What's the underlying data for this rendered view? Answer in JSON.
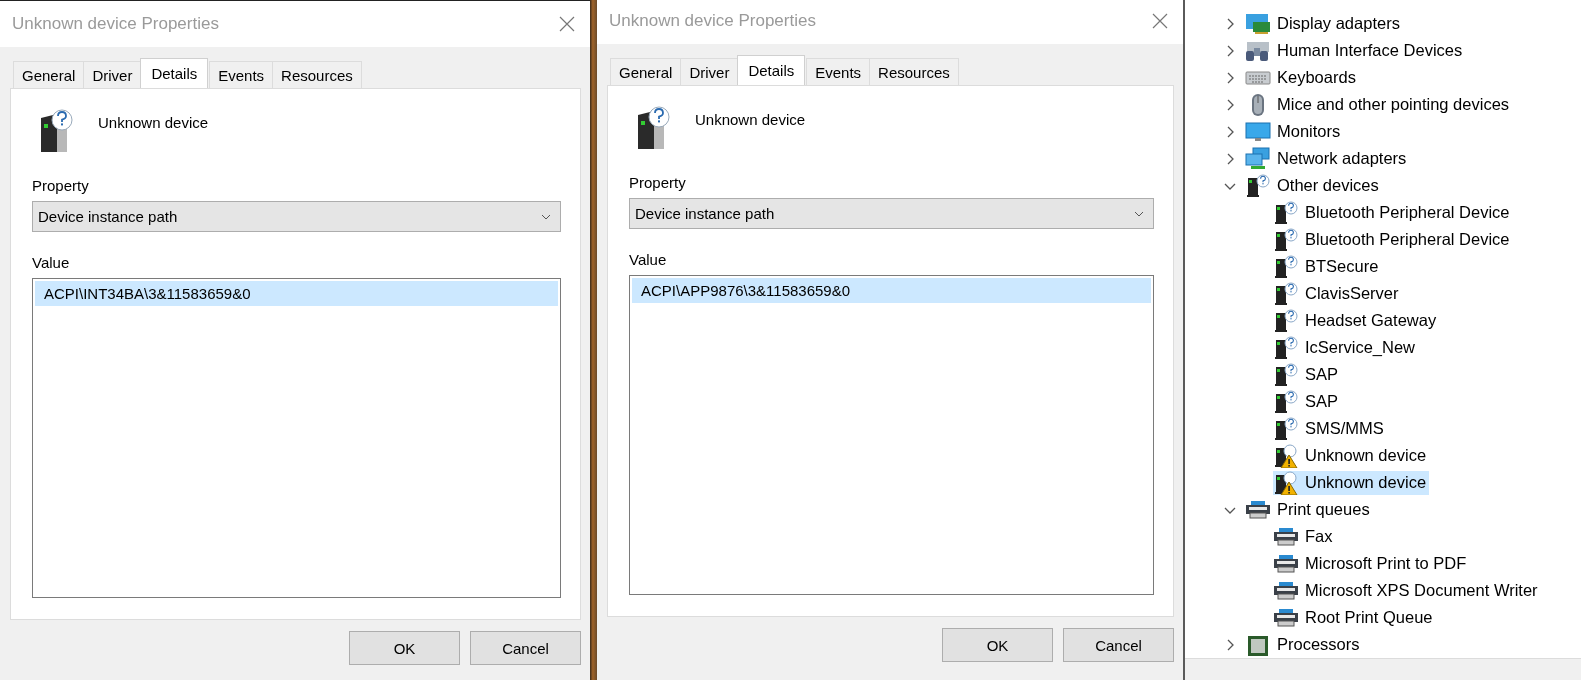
{
  "dialogs": [
    {
      "title": "Unknown device Properties",
      "tabs": [
        {
          "label": "General",
          "selected": false
        },
        {
          "label": "Driver",
          "selected": false
        },
        {
          "label": "Details",
          "selected": true
        },
        {
          "label": "Events",
          "selected": false
        },
        {
          "label": "Resources",
          "selected": false
        }
      ],
      "device_name": "Unknown device",
      "property_label": "Property",
      "property": "Device instance path",
      "value_label": "Value",
      "values": [
        {
          "text": "ACPI\\INT34BA\\3&11583659&0",
          "selected": true
        }
      ],
      "buttons": [
        "OK",
        "Cancel"
      ]
    },
    {
      "title": "Unknown device Properties",
      "tabs": [
        {
          "label": "General",
          "selected": false
        },
        {
          "label": "Driver",
          "selected": false
        },
        {
          "label": "Details",
          "selected": true
        },
        {
          "label": "Events",
          "selected": false
        },
        {
          "label": "Resources",
          "selected": false
        }
      ],
      "device_name": "Unknown device",
      "property_label": "Property",
      "property": "Device instance path",
      "value_label": "Value",
      "values": [
        {
          "text": "ACPI\\APP9876\\3&11583659&0",
          "selected": true
        }
      ],
      "buttons": [
        "OK",
        "Cancel"
      ]
    }
  ],
  "device_tree": [
    {
      "label": "Display adapters",
      "kind": "display",
      "expanded": false,
      "selected": false
    },
    {
      "label": "Human Interface Devices",
      "kind": "hid",
      "expanded": false,
      "selected": false
    },
    {
      "label": "Keyboards",
      "kind": "keyboard",
      "expanded": false,
      "selected": false
    },
    {
      "label": "Mice and other pointing devices",
      "kind": "mouse",
      "expanded": false,
      "selected": false
    },
    {
      "label": "Monitors",
      "kind": "monitor",
      "expanded": false,
      "selected": false
    },
    {
      "label": "Network adapters",
      "kind": "network",
      "expanded": false,
      "selected": false
    },
    {
      "label": "Other devices",
      "kind": "unknown",
      "expanded": true,
      "selected": false,
      "children": [
        {
          "label": "Bluetooth Peripheral Device",
          "kind": "unknown",
          "selected": false
        },
        {
          "label": "Bluetooth Peripheral Device",
          "kind": "unknown",
          "selected": false
        },
        {
          "label": "BTSecure",
          "kind": "unknown",
          "selected": false
        },
        {
          "label": "ClavisServer",
          "kind": "unknown",
          "selected": false
        },
        {
          "label": "Headset Gateway",
          "kind": "unknown",
          "selected": false
        },
        {
          "label": "IcService_New",
          "kind": "unknown",
          "selected": false
        },
        {
          "label": "SAP",
          "kind": "unknown",
          "selected": false
        },
        {
          "label": "SAP",
          "kind": "unknown",
          "selected": false
        },
        {
          "label": "SMS/MMS",
          "kind": "unknown",
          "selected": false
        },
        {
          "label": "Unknown device",
          "kind": "warning",
          "selected": false
        },
        {
          "label": "Unknown device",
          "kind": "warning",
          "selected": true
        }
      ]
    },
    {
      "label": "Print queues",
      "kind": "printer",
      "expanded": true,
      "selected": false,
      "children": [
        {
          "label": "Fax",
          "kind": "printer",
          "selected": false
        },
        {
          "label": "Microsoft Print to PDF",
          "kind": "printer",
          "selected": false
        },
        {
          "label": "Microsoft XPS Document Writer",
          "kind": "printer",
          "selected": false
        },
        {
          "label": "Root Print Queue",
          "kind": "printer",
          "selected": false
        }
      ]
    },
    {
      "label": "Processors",
      "kind": "processor",
      "expanded": false,
      "selected": false
    }
  ]
}
